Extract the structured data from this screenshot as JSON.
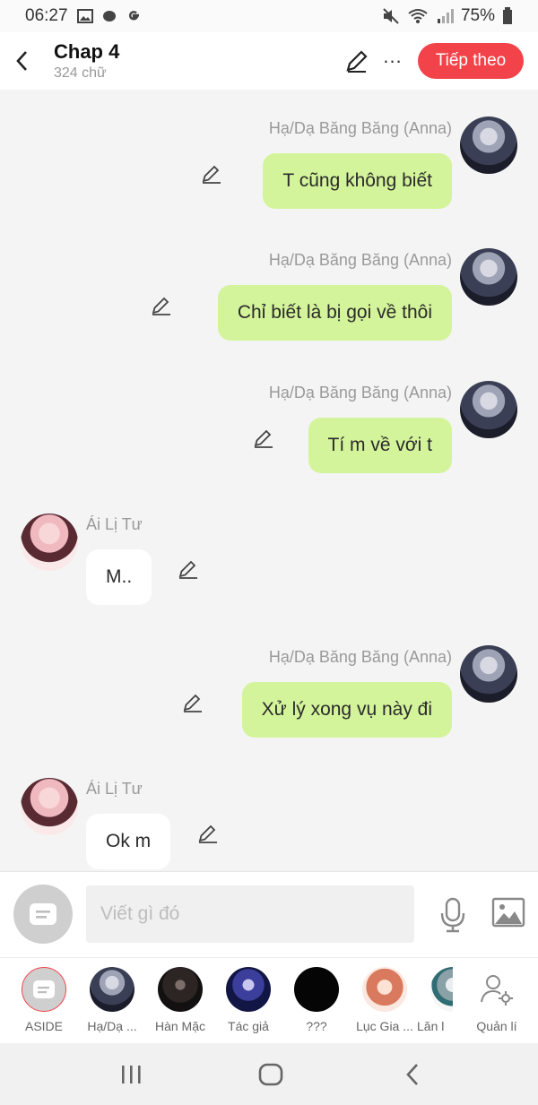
{
  "status": {
    "time": "06:27",
    "battery": "75%"
  },
  "header": {
    "title": "Chap 4",
    "word_count": "324 chữ",
    "next_label": "Tiếp theo",
    "more_label": "..."
  },
  "messages": [
    {
      "side": "me",
      "sender": "Hạ/Dạ Băng Băng (Anna)",
      "text": "T cũng không biết"
    },
    {
      "side": "me",
      "sender": "Hạ/Dạ Băng Băng (Anna)",
      "text": "Chỉ biết là bị gọi về thôi"
    },
    {
      "side": "me",
      "sender": "Hạ/Dạ Băng Băng (Anna)",
      "text": "Tí m về với t"
    },
    {
      "side": "them",
      "sender": "Ái Lị Tư",
      "text": "M.."
    },
    {
      "side": "me",
      "sender": "Hạ/Dạ Băng Băng (Anna)",
      "text": "Xử lý xong vụ này đi"
    },
    {
      "side": "them",
      "sender": "Ái Lị Tư",
      "text": "Ok m"
    }
  ],
  "composer": {
    "placeholder": "Viết gì đó"
  },
  "characters": [
    {
      "label": "ASIDE"
    },
    {
      "label": "Hạ/Dạ ..."
    },
    {
      "label": "Hàn Mặc"
    },
    {
      "label": "Tác giả"
    },
    {
      "label": "???"
    },
    {
      "label": "Lục Gia ..."
    },
    {
      "label": "Lăn l"
    }
  ],
  "manage_label": "Quản lí",
  "colors": {
    "accent": "#f2434a",
    "my_bubble": "#d4f49b",
    "their_bubble": "#ffffff",
    "background": "#f4f4f4"
  }
}
